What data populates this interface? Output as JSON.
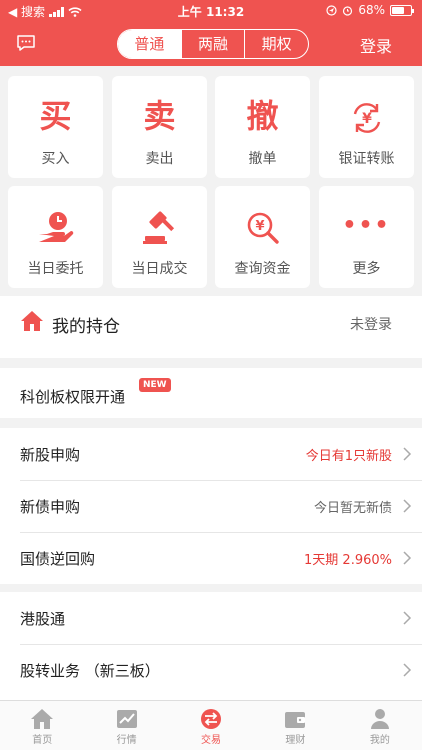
{
  "status_bar": {
    "back_label": "◀ 搜索",
    "time": "上午 11:32",
    "battery": "68%",
    "battery_level": 0.68
  },
  "nav": {
    "segments": [
      {
        "label": "普通",
        "active": true
      },
      {
        "label": "两融",
        "active": false
      },
      {
        "label": "期权",
        "active": false
      }
    ],
    "login": "登录"
  },
  "grid": [
    {
      "glyph": "买",
      "label": "买入",
      "icon": "buy-icon"
    },
    {
      "glyph": "卖",
      "label": "卖出",
      "icon": "sell-icon"
    },
    {
      "glyph": "撤",
      "label": "撤单",
      "icon": "cancel-order-icon"
    },
    {
      "glyph": "¥",
      "label": "银证转账",
      "icon": "bank-transfer-icon"
    },
    {
      "glyph": "",
      "label": "当日委托",
      "icon": "hand-clock-icon"
    },
    {
      "glyph": "",
      "label": "当日成交",
      "icon": "gavel-icon"
    },
    {
      "glyph": "¥",
      "label": "查询资金",
      "icon": "search-money-icon"
    },
    {
      "glyph": "•••",
      "label": "更多",
      "icon": "more-icon"
    }
  ],
  "holdings": {
    "title": "我的持仓",
    "status": "未登录"
  },
  "star_market": {
    "label": "科创板权限开通",
    "badge": "NEW"
  },
  "list_group_1": [
    {
      "label": "新股申购",
      "value": "今日有1只新股",
      "highlight": true
    },
    {
      "label": "新债申购",
      "value": "今日暂无新债",
      "highlight": false
    },
    {
      "label": "国债逆回购",
      "value": "1天期 2.960%",
      "highlight": true
    }
  ],
  "list_group_2": [
    {
      "label": "港股通"
    },
    {
      "label": "股转业务 （新三板）"
    }
  ],
  "tabbar": [
    {
      "label": "首页",
      "icon": "home-icon",
      "active": false
    },
    {
      "label": "行情",
      "icon": "chart-icon",
      "active": false
    },
    {
      "label": "交易",
      "icon": "trade-icon",
      "active": true
    },
    {
      "label": "理财",
      "icon": "wallet-icon",
      "active": false
    },
    {
      "label": "我的",
      "icon": "profile-icon",
      "active": false
    }
  ],
  "colors": {
    "accent": "#ef5350",
    "background": "#f2f2f2"
  }
}
